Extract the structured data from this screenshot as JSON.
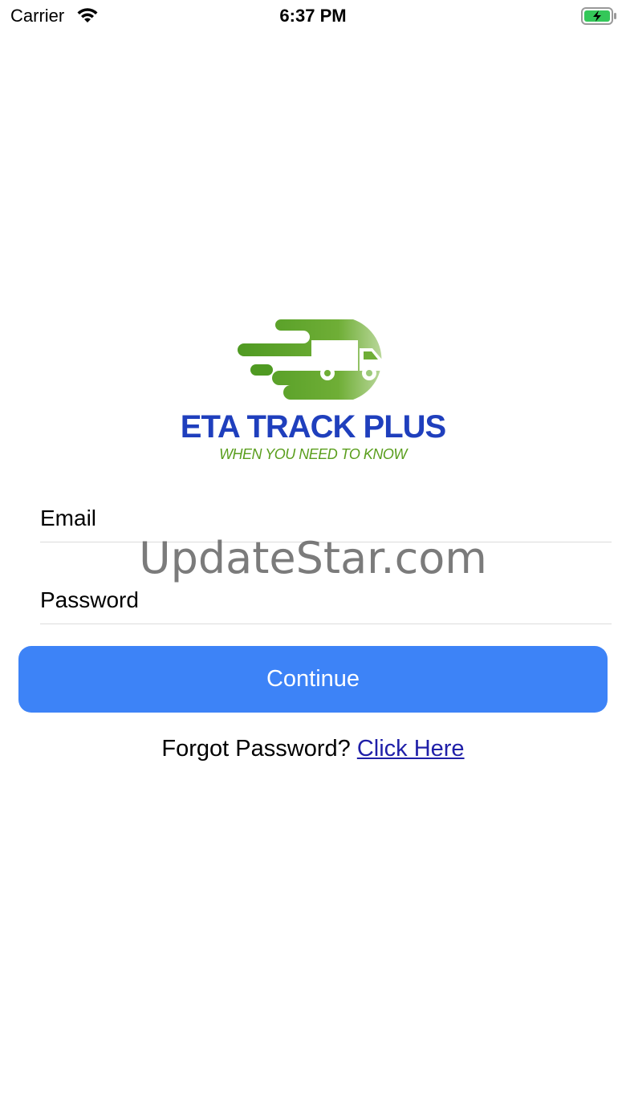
{
  "status_bar": {
    "carrier": "Carrier",
    "time": "6:37 PM",
    "battery_color": "#34c759"
  },
  "logo": {
    "title": "ETA TRACK PLUS",
    "tagline": "WHEN YOU NEED TO KNOW",
    "icon": "delivery-truck-icon",
    "title_color": "#1f3fbd",
    "accent_color": "#5a9e1d"
  },
  "form": {
    "email_placeholder": "Email",
    "password_placeholder": "Password",
    "continue_label": "Continue",
    "button_color": "#3d83f7"
  },
  "forgot": {
    "prompt": "Forgot Password?",
    "link_label": "Click Here"
  },
  "watermark": "UpdateStar.com"
}
